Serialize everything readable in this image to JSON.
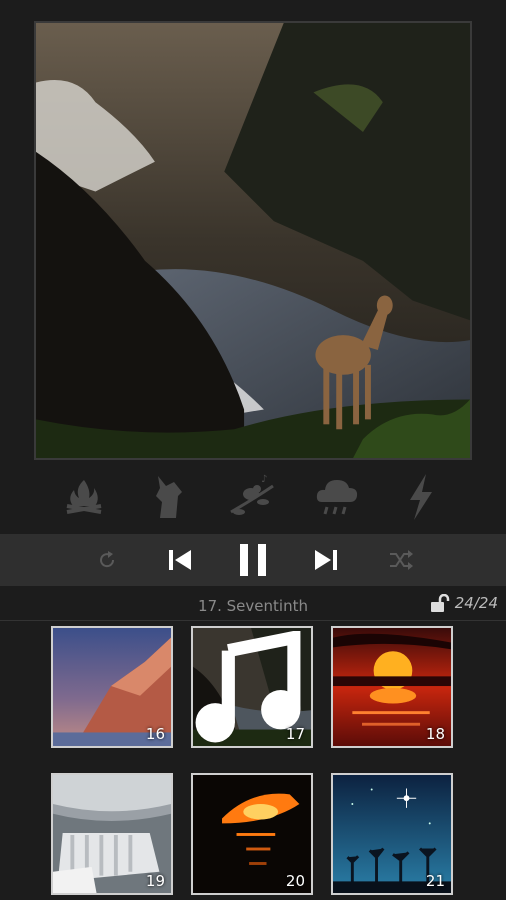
{
  "now_playing": {
    "title": "17. Seventinth"
  },
  "unlock": {
    "count": "24/24",
    "icon": "unlock-icon"
  },
  "ambience": [
    {
      "icon": "campfire-icon"
    },
    {
      "icon": "wolf-icon"
    },
    {
      "icon": "bird-branch-icon"
    },
    {
      "icon": "rain-cloud-icon"
    },
    {
      "icon": "lightning-icon"
    }
  ],
  "controls": {
    "repeat": "repeat-icon",
    "previous": "skip-previous-icon",
    "pause": "pause-icon",
    "next": "skip-next-icon",
    "shuffle": "shuffle-icon"
  },
  "tracks": [
    {
      "number": "16"
    },
    {
      "number": "17",
      "badge": "music-note-icon"
    },
    {
      "number": "18"
    },
    {
      "number": "19"
    },
    {
      "number": "20"
    },
    {
      "number": "21"
    }
  ],
  "colors": {
    "background": "#1c1c1c",
    "control_bar": "#2f2f2f",
    "icon_dim": "#4a4a4a"
  }
}
